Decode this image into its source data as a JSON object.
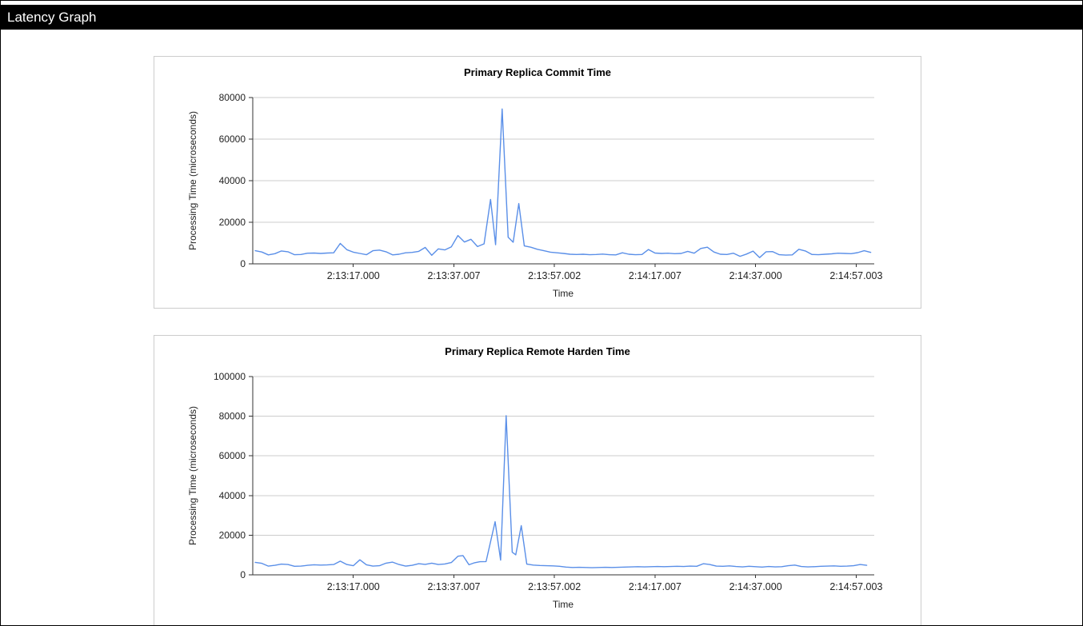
{
  "window": {
    "title": "Latency Graph"
  },
  "chart_data": [
    {
      "type": "line",
      "title": "Primary Replica Commit Time",
      "xlabel": "Time",
      "ylabel": "Processing Time (microseconds)",
      "ylim": [
        0,
        80000
      ],
      "yticks": [
        0,
        20000,
        40000,
        60000,
        80000
      ],
      "x_range": [
        0,
        123.6
      ],
      "xticks": [
        {
          "t": 20.0,
          "label": "2:13:17.000"
        },
        {
          "t": 40.007,
          "label": "2:13:37.007"
        },
        {
          "t": 60.002,
          "label": "2:13:57.002"
        },
        {
          "t": 80.007,
          "label": "2:14:17.007"
        },
        {
          "t": 100.0,
          "label": "2:14:37.000"
        },
        {
          "t": 120.003,
          "label": "2:14:57.003"
        }
      ],
      "grid": true,
      "legend": "none",
      "line_color": "#5a8fe8",
      "grid_color": "#cccccc",
      "axis_color": "#333333",
      "points": [
        [
          0.5,
          6300
        ],
        [
          1.8,
          5700
        ],
        [
          3.1,
          4300
        ],
        [
          4.4,
          4900
        ],
        [
          5.7,
          6200
        ],
        [
          7.0,
          5800
        ],
        [
          8.3,
          4400
        ],
        [
          9.6,
          4500
        ],
        [
          10.9,
          5100
        ],
        [
          12.2,
          5200
        ],
        [
          13.5,
          5000
        ],
        [
          14.8,
          5200
        ],
        [
          16.1,
          5300
        ],
        [
          17.4,
          9800
        ],
        [
          18.7,
          6800
        ],
        [
          20.0,
          5600
        ],
        [
          21.3,
          5000
        ],
        [
          22.6,
          4400
        ],
        [
          23.9,
          6300
        ],
        [
          25.2,
          6600
        ],
        [
          26.5,
          5800
        ],
        [
          27.8,
          4300
        ],
        [
          29.1,
          4600
        ],
        [
          30.4,
          5300
        ],
        [
          31.7,
          5500
        ],
        [
          33.0,
          6000
        ],
        [
          34.3,
          7900
        ],
        [
          35.6,
          4100
        ],
        [
          36.9,
          7200
        ],
        [
          38.2,
          6700
        ],
        [
          39.5,
          8200
        ],
        [
          40.8,
          13600
        ],
        [
          42.1,
          10500
        ],
        [
          43.4,
          11800
        ],
        [
          44.7,
          8300
        ],
        [
          46.0,
          9600
        ],
        [
          47.3,
          31000
        ],
        [
          48.3,
          9200
        ],
        [
          49.6,
          74500
        ],
        [
          50.8,
          12800
        ],
        [
          51.8,
          10400
        ],
        [
          52.9,
          29000
        ],
        [
          54.0,
          8600
        ],
        [
          55.3,
          8000
        ],
        [
          56.6,
          7000
        ],
        [
          57.9,
          6300
        ],
        [
          59.2,
          5600
        ],
        [
          60.5,
          5300
        ],
        [
          61.8,
          5000
        ],
        [
          63.1,
          4600
        ],
        [
          64.4,
          4500
        ],
        [
          65.7,
          4600
        ],
        [
          67.0,
          4400
        ],
        [
          68.3,
          4500
        ],
        [
          69.6,
          4700
        ],
        [
          70.9,
          4400
        ],
        [
          72.2,
          4300
        ],
        [
          73.5,
          5300
        ],
        [
          74.8,
          4600
        ],
        [
          76.1,
          4400
        ],
        [
          77.4,
          4500
        ],
        [
          78.7,
          6900
        ],
        [
          80.0,
          5200
        ],
        [
          81.3,
          5000
        ],
        [
          82.6,
          5100
        ],
        [
          83.9,
          4900
        ],
        [
          85.2,
          5000
        ],
        [
          86.5,
          6000
        ],
        [
          87.8,
          5100
        ],
        [
          89.1,
          7400
        ],
        [
          90.4,
          8000
        ],
        [
          91.7,
          5700
        ],
        [
          93.0,
          4600
        ],
        [
          94.3,
          4500
        ],
        [
          95.6,
          5100
        ],
        [
          96.9,
          3600
        ],
        [
          98.2,
          4700
        ],
        [
          99.5,
          6100
        ],
        [
          100.8,
          3000
        ],
        [
          102.1,
          5800
        ],
        [
          103.4,
          5900
        ],
        [
          104.7,
          4400
        ],
        [
          106.0,
          4200
        ],
        [
          107.3,
          4300
        ],
        [
          108.6,
          7000
        ],
        [
          109.9,
          6200
        ],
        [
          111.2,
          4500
        ],
        [
          112.5,
          4400
        ],
        [
          113.8,
          4600
        ],
        [
          115.1,
          4800
        ],
        [
          116.4,
          5100
        ],
        [
          117.7,
          5000
        ],
        [
          119.0,
          4900
        ],
        [
          120.3,
          5400
        ],
        [
          121.6,
          6300
        ],
        [
          122.9,
          5500
        ]
      ]
    },
    {
      "type": "line",
      "title": "Primary Replica Remote Harden Time",
      "xlabel": "Time",
      "ylabel": "Processing Time (microseconds)",
      "ylim": [
        0,
        100000
      ],
      "yticks": [
        0,
        20000,
        40000,
        60000,
        80000,
        100000
      ],
      "x_range": [
        0,
        123.6
      ],
      "xticks": [
        {
          "t": 20.0,
          "label": "2:13:17.000"
        },
        {
          "t": 40.007,
          "label": "2:13:37.007"
        },
        {
          "t": 60.002,
          "label": "2:13:57.002"
        },
        {
          "t": 80.007,
          "label": "2:14:17.007"
        },
        {
          "t": 100.0,
          "label": "2:14:37.000"
        },
        {
          "t": 120.003,
          "label": "2:14:57.003"
        }
      ],
      "grid": true,
      "legend": "none",
      "line_color": "#5a8fe8",
      "grid_color": "#cccccc",
      "axis_color": "#333333",
      "points": [
        [
          0.5,
          6300
        ],
        [
          1.8,
          5800
        ],
        [
          3.1,
          4400
        ],
        [
          4.4,
          4800
        ],
        [
          5.7,
          5400
        ],
        [
          7.0,
          5200
        ],
        [
          8.3,
          4300
        ],
        [
          9.6,
          4400
        ],
        [
          10.9,
          4800
        ],
        [
          12.2,
          5100
        ],
        [
          13.5,
          4900
        ],
        [
          14.8,
          5000
        ],
        [
          16.1,
          5200
        ],
        [
          17.4,
          6900
        ],
        [
          18.7,
          5200
        ],
        [
          20.0,
          4600
        ],
        [
          21.3,
          7600
        ],
        [
          22.6,
          5100
        ],
        [
          23.9,
          4400
        ],
        [
          25.2,
          4600
        ],
        [
          26.5,
          5900
        ],
        [
          27.8,
          6400
        ],
        [
          29.1,
          5200
        ],
        [
          30.4,
          4400
        ],
        [
          31.7,
          4800
        ],
        [
          33.0,
          5600
        ],
        [
          34.3,
          5300
        ],
        [
          35.6,
          5900
        ],
        [
          36.9,
          5200
        ],
        [
          38.2,
          5500
        ],
        [
          39.5,
          6200
        ],
        [
          40.8,
          9400
        ],
        [
          41.8,
          9700
        ],
        [
          43.0,
          5100
        ],
        [
          44.0,
          6000
        ],
        [
          45.2,
          6600
        ],
        [
          46.4,
          6700
        ],
        [
          48.2,
          26800
        ],
        [
          49.3,
          7400
        ],
        [
          50.4,
          80300
        ],
        [
          51.6,
          11400
        ],
        [
          52.3,
          10100
        ],
        [
          53.4,
          24800
        ],
        [
          54.5,
          5400
        ],
        [
          55.8,
          4900
        ],
        [
          57.1,
          4700
        ],
        [
          58.4,
          4600
        ],
        [
          59.7,
          4500
        ],
        [
          61.0,
          4300
        ],
        [
          62.3,
          3900
        ],
        [
          63.6,
          3700
        ],
        [
          64.9,
          3800
        ],
        [
          66.2,
          3700
        ],
        [
          67.5,
          3600
        ],
        [
          68.8,
          3700
        ],
        [
          70.1,
          3800
        ],
        [
          71.4,
          3700
        ],
        [
          72.7,
          3800
        ],
        [
          74.0,
          3900
        ],
        [
          75.3,
          4000
        ],
        [
          76.6,
          4100
        ],
        [
          77.9,
          4000
        ],
        [
          79.2,
          4100
        ],
        [
          80.5,
          4200
        ],
        [
          81.8,
          4100
        ],
        [
          83.1,
          4200
        ],
        [
          84.4,
          4300
        ],
        [
          85.7,
          4200
        ],
        [
          87.0,
          4400
        ],
        [
          88.3,
          4300
        ],
        [
          89.6,
          5600
        ],
        [
          90.9,
          5200
        ],
        [
          92.2,
          4400
        ],
        [
          93.5,
          4300
        ],
        [
          94.8,
          4500
        ],
        [
          96.1,
          4200
        ],
        [
          97.4,
          4000
        ],
        [
          98.7,
          4300
        ],
        [
          100.0,
          4100
        ],
        [
          101.3,
          3900
        ],
        [
          102.6,
          4200
        ],
        [
          103.9,
          4000
        ],
        [
          105.2,
          4100
        ],
        [
          106.5,
          4600
        ],
        [
          107.8,
          4900
        ],
        [
          109.1,
          4200
        ],
        [
          110.4,
          4000
        ],
        [
          111.7,
          4100
        ],
        [
          113.0,
          4300
        ],
        [
          114.3,
          4400
        ],
        [
          115.6,
          4500
        ],
        [
          116.9,
          4300
        ],
        [
          118.2,
          4400
        ],
        [
          119.5,
          4600
        ],
        [
          120.8,
          5200
        ],
        [
          122.1,
          4800
        ]
      ]
    }
  ]
}
